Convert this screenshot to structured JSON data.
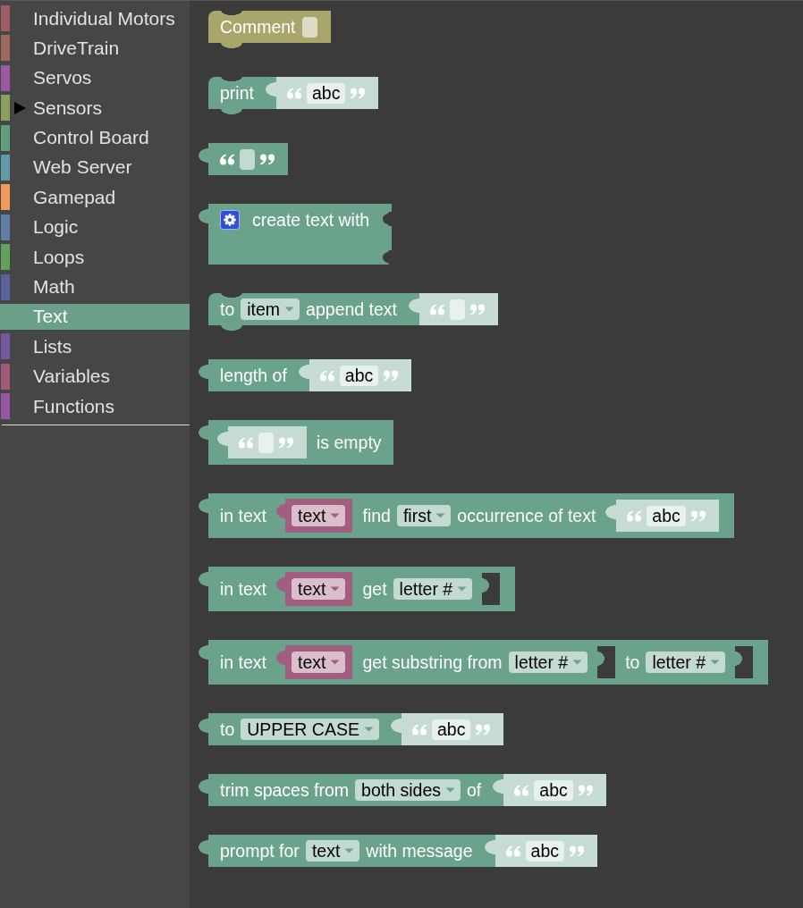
{
  "sidebar": {
    "categories": [
      {
        "label": "Individual Motors",
        "color": "#9e5c64",
        "selected": false
      },
      {
        "label": "DriveTrain",
        "color": "#a0685e",
        "selected": false
      },
      {
        "label": "Servos",
        "color": "#9c58a2",
        "selected": false
      },
      {
        "label": "Sensors",
        "color": "#8ca05e",
        "selected": false,
        "expanded": false
      },
      {
        "label": "Control Board",
        "color": "#5ea07d",
        "selected": false
      },
      {
        "label": "Web Server",
        "color": "#5f9aa8",
        "selected": false
      },
      {
        "label": "Gamepad",
        "color": "#f29a5c",
        "selected": false
      },
      {
        "label": "Logic",
        "color": "#5e7ea6",
        "selected": false
      },
      {
        "label": "Loops",
        "color": "#63a05e",
        "selected": false
      },
      {
        "label": "Math",
        "color": "#5a62a0",
        "selected": false
      },
      {
        "label": "Text",
        "color": "#6aa08a",
        "selected": true
      },
      {
        "label": "Lists",
        "color": "#7458a2",
        "selected": false
      },
      {
        "label": "Variables",
        "color": "#a05a7a",
        "selected": false
      },
      {
        "label": "Functions",
        "color": "#9856a4",
        "selected": false
      }
    ]
  },
  "flyout": {
    "blocks": [
      {
        "kind": "statement",
        "color": "#a8a66a",
        "parts": [
          {
            "kind": "label",
            "text": "Comment"
          },
          {
            "kind": "field"
          }
        ]
      },
      {
        "kind": "statement",
        "color": "#6aa28b",
        "parts": [
          {
            "kind": "label",
            "text": "print"
          },
          {
            "kind": "string",
            "text": "abc"
          }
        ]
      },
      {
        "kind": "literal",
        "color": "#6aa28b"
      },
      {
        "kind": "value",
        "color": "#6aa28b",
        "parts": [
          {
            "kind": "mutator"
          },
          {
            "kind": "label",
            "text": "create text with"
          },
          {
            "kind": "notch"
          },
          {
            "kind": "notch"
          }
        ]
      },
      {
        "kind": "statement",
        "color": "#6aa28b",
        "parts": [
          {
            "kind": "label",
            "text": "to"
          },
          {
            "kind": "dropdown",
            "text": "item"
          },
          {
            "kind": "label",
            "text": "append text"
          },
          {
            "kind": "string"
          }
        ]
      },
      {
        "kind": "value",
        "color": "#6aa28b",
        "parts": [
          {
            "kind": "label",
            "text": "length of"
          },
          {
            "kind": "string",
            "text": "abc"
          }
        ]
      },
      {
        "kind": "value",
        "color": "#6aa28b",
        "parts": [
          {
            "kind": "string"
          },
          {
            "kind": "label",
            "text": "is empty"
          }
        ]
      },
      {
        "kind": "value",
        "color": "#6aa28b",
        "parts": [
          {
            "kind": "label",
            "text": "in text"
          },
          {
            "kind": "variable",
            "text": "text"
          },
          {
            "kind": "label",
            "text": "find"
          },
          {
            "kind": "dropdown",
            "text": "first"
          },
          {
            "kind": "label",
            "text": "occurrence of text"
          },
          {
            "kind": "string",
            "text": "abc"
          }
        ]
      },
      {
        "kind": "value",
        "color": "#6aa28b",
        "parts": [
          {
            "kind": "label",
            "text": "in text"
          },
          {
            "kind": "variable",
            "text": "text"
          },
          {
            "kind": "label",
            "text": "get"
          },
          {
            "kind": "dropdown",
            "text": "letter #"
          },
          {
            "kind": "socket"
          }
        ]
      },
      {
        "kind": "value",
        "color": "#6aa28b",
        "parts": [
          {
            "kind": "label",
            "text": "in text"
          },
          {
            "kind": "variable",
            "text": "text"
          },
          {
            "kind": "label",
            "text": "get substring from"
          },
          {
            "kind": "dropdown",
            "text": "letter #"
          },
          {
            "kind": "socket"
          },
          {
            "kind": "label",
            "text": "to"
          },
          {
            "kind": "dropdown",
            "text": "letter #"
          },
          {
            "kind": "socket"
          }
        ]
      },
      {
        "kind": "value",
        "color": "#6aa28b",
        "parts": [
          {
            "kind": "label",
            "text": "to"
          },
          {
            "kind": "dropdown",
            "text": "UPPER CASE"
          },
          {
            "kind": "string",
            "text": "abc"
          }
        ]
      },
      {
        "kind": "value",
        "color": "#6aa28b",
        "parts": [
          {
            "kind": "label",
            "text": "trim spaces from"
          },
          {
            "kind": "dropdown",
            "text": "both sides"
          },
          {
            "kind": "label",
            "text": "of"
          },
          {
            "kind": "string",
            "text": "abc"
          }
        ]
      },
      {
        "kind": "value",
        "color": "#6aa28b",
        "parts": [
          {
            "kind": "label",
            "text": "prompt for"
          },
          {
            "kind": "dropdown",
            "text": "text"
          },
          {
            "kind": "label",
            "text": "with message"
          },
          {
            "kind": "string",
            "text": "abc"
          }
        ]
      }
    ]
  }
}
